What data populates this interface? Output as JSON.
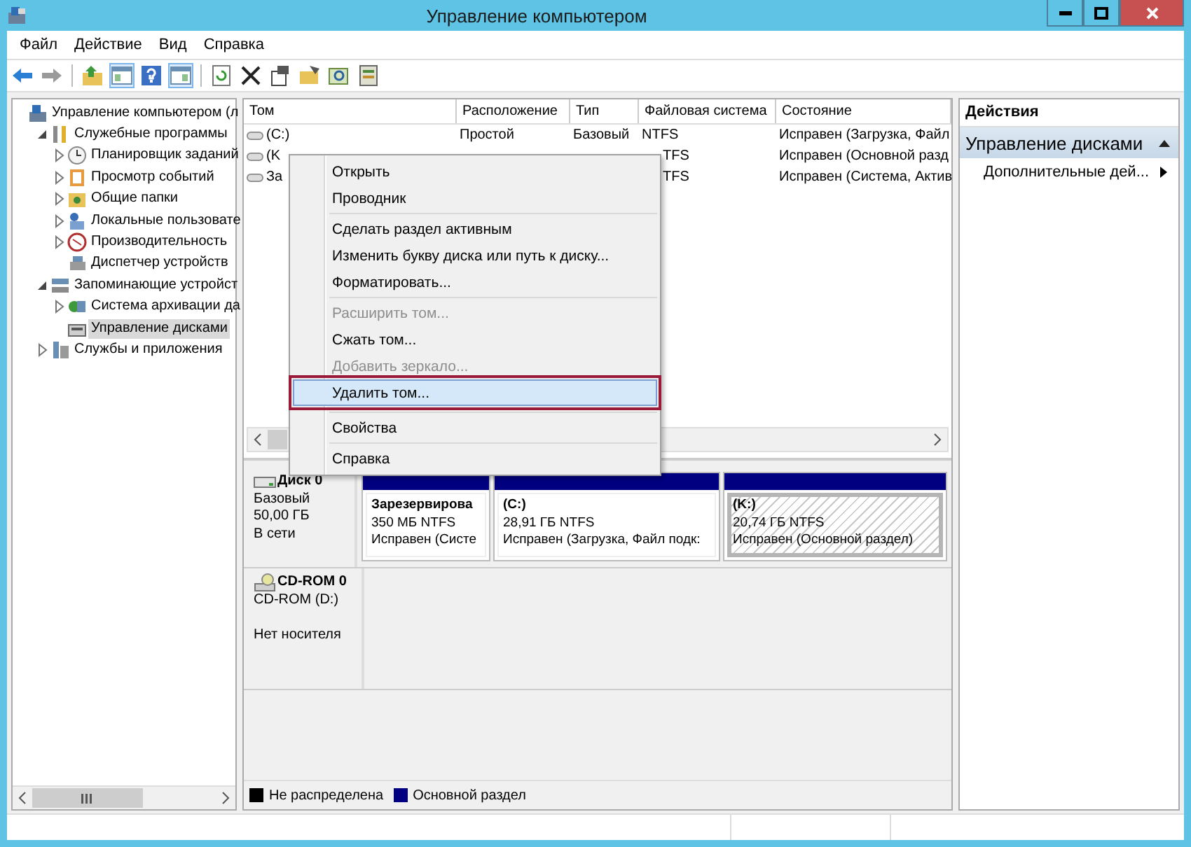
{
  "window": {
    "title": "Управление компьютером"
  },
  "menu": [
    "Файл",
    "Действие",
    "Вид",
    "Справка"
  ],
  "tree": [
    {
      "label": "Управление компьютером (л",
      "kind": "root",
      "selected": false,
      "children": [
        {
          "label": "Служебные программы",
          "kind": "node",
          "expanded": true,
          "selected": false,
          "children": [
            {
              "label": "Планировщик заданий",
              "kind": "node",
              "expanded": false,
              "selected": false
            },
            {
              "label": "Просмотр событий",
              "kind": "node",
              "expanded": false,
              "selected": false
            },
            {
              "label": "Общие папки",
              "kind": "node",
              "expanded": false,
              "selected": false
            },
            {
              "label": "Локальные пользовате",
              "kind": "node",
              "expanded": false,
              "selected": false
            },
            {
              "label": "Производительность",
              "kind": "node",
              "expanded": false,
              "selected": false
            },
            {
              "label": "Диспетчер устройств",
              "kind": "leaf",
              "selected": false
            }
          ]
        },
        {
          "label": "Запоминающие устройст",
          "kind": "node",
          "expanded": true,
          "selected": false,
          "children": [
            {
              "label": "Система архивации да",
              "kind": "node",
              "expanded": false,
              "selected": false
            },
            {
              "label": "Управление дисками",
              "kind": "leaf",
              "selected": true
            }
          ]
        },
        {
          "label": "Службы и приложения",
          "kind": "node",
          "expanded": false,
          "selected": false
        }
      ]
    }
  ],
  "table": {
    "columns": [
      "Том",
      "Расположение",
      "Тип",
      "Файловая система",
      "Состояние"
    ],
    "rows": [
      {
        "cells": [
          "(C:)",
          "Простой",
          "Базовый",
          "NTFS",
          "Исправен (Загрузка, Файл"
        ],
        "covered": false
      },
      {
        "cells": [
          "(K",
          "",
          "",
          "TFS",
          "Исправен (Основной разд"
        ],
        "covered": true
      },
      {
        "cells": [
          "За",
          "",
          "",
          "TFS",
          "Исправен (Система, Актив"
        ],
        "covered": true
      }
    ]
  },
  "context_menu": {
    "groups": [
      [
        {
          "label": "Открыть",
          "disabled": false,
          "selected": false
        },
        {
          "label": "Проводник",
          "disabled": false,
          "selected": false
        }
      ],
      [
        {
          "label": "Сделать раздел активным",
          "disabled": false,
          "selected": false
        },
        {
          "label": "Изменить букву диска или путь к диску...",
          "disabled": false,
          "selected": false
        },
        {
          "label": "Форматировать...",
          "disabled": false,
          "selected": false
        }
      ],
      [
        {
          "label": "Расширить том...",
          "disabled": true,
          "selected": false
        },
        {
          "label": "Сжать том...",
          "disabled": false,
          "selected": false
        },
        {
          "label": "Добавить зеркало...",
          "disabled": true,
          "selected": false
        },
        {
          "label": "Удалить том...",
          "disabled": false,
          "selected": true
        }
      ],
      [
        {
          "label": "Свойства",
          "disabled": false,
          "selected": false
        }
      ],
      [
        {
          "label": "Справка",
          "disabled": false,
          "selected": false
        }
      ]
    ]
  },
  "disks": [
    {
      "name": "Диск 0",
      "kind": "disk",
      "lines": [
        "Базовый",
        "50,00 ГБ",
        "В сети"
      ],
      "partitions": [
        {
          "name": "Зарезервирова",
          "size": "350 МБ NTFS",
          "status": "Исправен (Систе",
          "selected": false
        },
        {
          "name": "(C:)",
          "size": "28,91 ГБ NTFS",
          "status": "Исправен (Загрузка, Файл подк:",
          "selected": false
        },
        {
          "name": "(K:)",
          "size": "20,74 ГБ NTFS",
          "status": "Исправен (Основной раздел)",
          "selected": true
        }
      ]
    },
    {
      "name": "CD-ROM 0",
      "kind": "cdrom",
      "lines": [
        "CD-ROM (D:)"
      ],
      "note": "Нет носителя"
    }
  ],
  "legend": [
    {
      "label": "Не распределена",
      "color": "#000000"
    },
    {
      "label": "Основной раздел",
      "color": "#000080"
    }
  ],
  "actions": {
    "title": "Действия",
    "sections": [
      {
        "title": "Управление дисками",
        "expanded": true,
        "items": [
          {
            "label": "Дополнительные дей...",
            "kind": "submenu"
          }
        ]
      }
    ]
  }
}
